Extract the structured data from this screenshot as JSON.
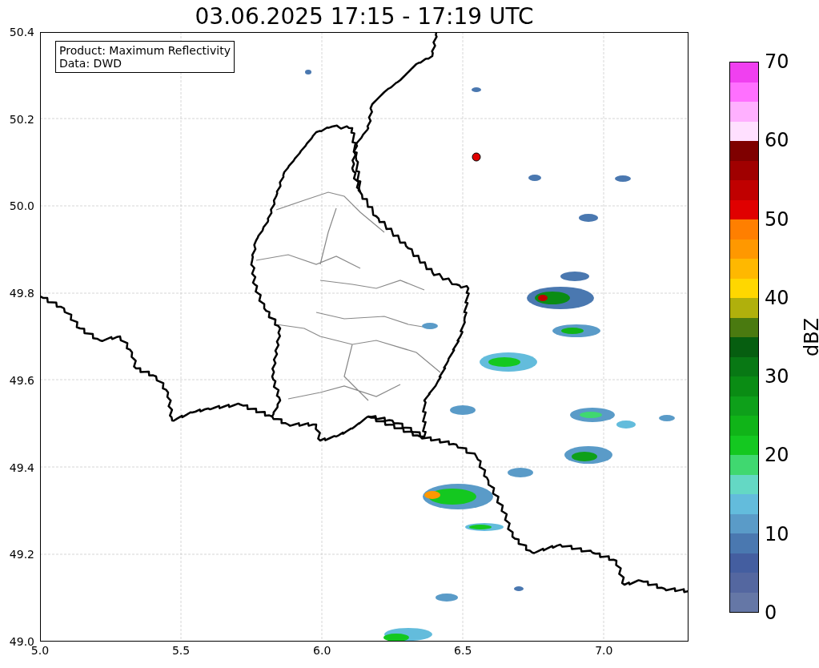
{
  "title": "03.06.2025 17:15 - 17:19 UTC",
  "info_box": [
    "Product: Maximum Reflectivity",
    "Data: DWD"
  ],
  "y_axis": {
    "ticks": [
      "50.4",
      "50.2",
      "50.0",
      "49.8",
      "49.6",
      "49.4",
      "49.2",
      "49.0"
    ]
  },
  "x_axis": {
    "ticks": [
      "5.0",
      "5.5",
      "6.0",
      "6.5",
      "7.0"
    ]
  },
  "colorbar": {
    "label": "dBZ",
    "ticks": [
      "70",
      "60",
      "50",
      "40",
      "30",
      "20",
      "10",
      "0"
    ],
    "bins": [
      {
        "color": "#f040f0"
      },
      {
        "color": "#ff70ff"
      },
      {
        "color": "#ffb0ff"
      },
      {
        "color": "#ffe0ff"
      },
      {
        "color": "#7f0000"
      },
      {
        "color": "#a00000"
      },
      {
        "color": "#c00000"
      },
      {
        "color": "#e00000"
      },
      {
        "color": "#ff7f00"
      },
      {
        "color": "#ff9800"
      },
      {
        "color": "#ffb800"
      },
      {
        "color": "#ffd700"
      },
      {
        "color": "#b0b00c"
      },
      {
        "color": "#4a7a10"
      },
      {
        "color": "#065e10"
      },
      {
        "color": "#087814"
      },
      {
        "color": "#0a8c14"
      },
      {
        "color": "#0ea01a"
      },
      {
        "color": "#10b418"
      },
      {
        "color": "#14c820"
      },
      {
        "color": "#40d870"
      },
      {
        "color": "#64d8c4"
      },
      {
        "color": "#63bcdc"
      },
      {
        "color": "#5a9bc8"
      },
      {
        "color": "#4a78b0"
      },
      {
        "color": "#445ea0"
      },
      {
        "color": "#5467a0"
      },
      {
        "color": "#6577a6"
      }
    ]
  }
}
